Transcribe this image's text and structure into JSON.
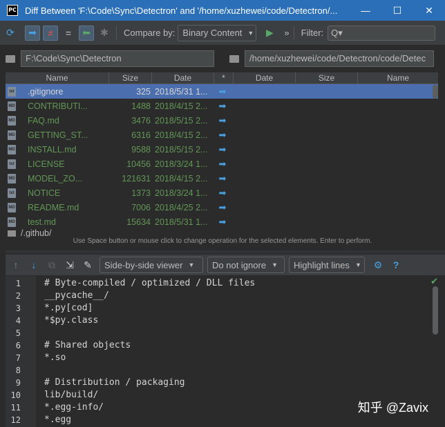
{
  "window": {
    "title": "Diff Between 'F:\\Code\\Sync\\Detectron' and '/home/xuzhewei/code/Detectron/...",
    "app_icon": "PC",
    "controls": [
      "—",
      "☐",
      "✕"
    ]
  },
  "toolbar": {
    "compare_by_label": "Compare by:",
    "compare_by_value": "Binary Content",
    "filter_label": "Filter:",
    "filter_icon": "Q▾",
    "more": "»"
  },
  "paths": {
    "left": "F:\\Code\\Sync\\Detectron",
    "right": "/home/xuzhewei/code/Detectron/code/Detec"
  },
  "table": {
    "headers": [
      "Name",
      "Size",
      "Date",
      "*",
      "Date",
      "Size",
      "Name"
    ],
    "rows": [
      {
        "name": ".gitignore",
        "size": "325",
        "date": "2018/5/31 1...",
        "op": "➡",
        "type": "txt"
      },
      {
        "name": "CONTRIBUTI...",
        "size": "1488",
        "date": "2018/4/15 2...",
        "op": "➡",
        "type": "MD"
      },
      {
        "name": "FAQ.md",
        "size": "3476",
        "date": "2018/5/15 2...",
        "op": "➡",
        "type": "MD"
      },
      {
        "name": "GETTING_ST...",
        "size": "6316",
        "date": "2018/4/15 2...",
        "op": "➡",
        "type": "MD"
      },
      {
        "name": "INSTALL.md",
        "size": "9588",
        "date": "2018/5/15 2...",
        "op": "➡",
        "type": "MD"
      },
      {
        "name": "LICENSE",
        "size": "10456",
        "date": "2018/3/24 1...",
        "op": "➡",
        "type": "txt"
      },
      {
        "name": "MODEL_ZO...",
        "size": "121631",
        "date": "2018/4/15 2...",
        "op": "➡",
        "type": "MD"
      },
      {
        "name": "NOTICE",
        "size": "1373",
        "date": "2018/3/24 1...",
        "op": "➡",
        "type": "txt"
      },
      {
        "name": "README.md",
        "size": "7006",
        "date": "2018/4/25 2...",
        "op": "➡",
        "type": "MD"
      },
      {
        "name": "test.md",
        "size": "15634",
        "date": "2018/5/31 1...",
        "op": "➡",
        "type": "MD"
      }
    ],
    "partial_row": "/.github/"
  },
  "hint": "Use Space button or mouse click to change operation for the selected elements. Enter to perform.",
  "diff_toolbar": {
    "viewer": "Side-by-side viewer",
    "ignore": "Do not ignore",
    "highlight": "Highlight lines",
    "help": "?"
  },
  "editor": {
    "lines": [
      {
        "n": "1",
        "text": "# Byte-compiled / optimized / DLL files"
      },
      {
        "n": "2",
        "text": "__pycache__/"
      },
      {
        "n": "3",
        "text": "*.py[cod]"
      },
      {
        "n": "4",
        "text": "*$py.class"
      },
      {
        "n": "5",
        "text": ""
      },
      {
        "n": "6",
        "text": "# Shared objects"
      },
      {
        "n": "7",
        "text": "*.so"
      },
      {
        "n": "8",
        "text": ""
      },
      {
        "n": "9",
        "text": "# Distribution / packaging"
      },
      {
        "n": "10",
        "text": "lib/build/"
      },
      {
        "n": "11",
        "text": "*.egg-info/"
      },
      {
        "n": "12",
        "text": "*.egg"
      }
    ],
    "watermark": "知乎 @Zavix"
  },
  "colors": {
    "titlebar": "#2a6fb8",
    "selection": "#4b6eaf",
    "added_text": "#629755",
    "arrow": "#4a9fdf"
  }
}
